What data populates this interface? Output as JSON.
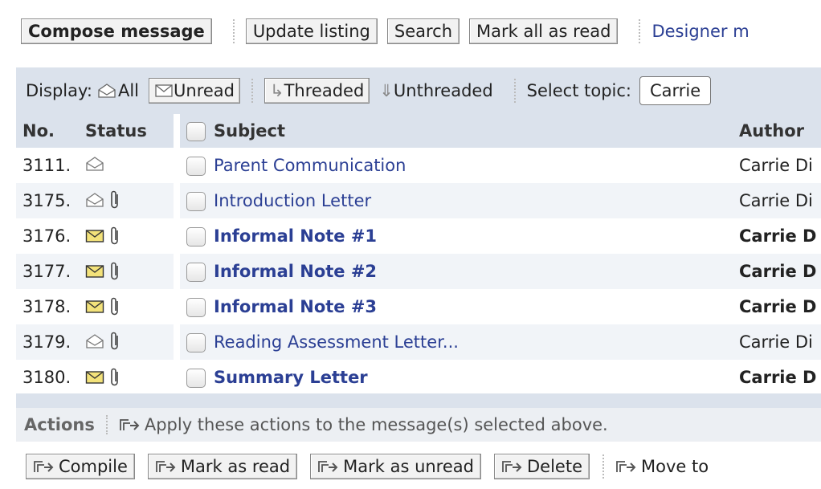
{
  "toolbar": {
    "compose": "Compose message",
    "update": "Update listing",
    "search": "Search",
    "mark_all_read": "Mark all as read",
    "designer_link": "Designer m"
  },
  "display": {
    "label": "Display:",
    "all": "All",
    "unread": "Unread",
    "threaded": "Threaded",
    "unthreaded": "Unthreaded",
    "topic_label": "Select topic:",
    "topic_value": "Carrie"
  },
  "table": {
    "headers": {
      "no": "No.",
      "status": "Status",
      "subject": "Subject",
      "author": "Author"
    },
    "rows": [
      {
        "no": "3111.",
        "subject": "Parent Communication",
        "author": "Carrie Di",
        "unread": false,
        "attachment": false
      },
      {
        "no": "3175.",
        "subject": "Introduction Letter",
        "author": "Carrie Di",
        "unread": false,
        "attachment": true
      },
      {
        "no": "3176.",
        "subject": "Informal Note #1",
        "author": "Carrie D",
        "unread": true,
        "attachment": true
      },
      {
        "no": "3177.",
        "subject": "Informal Note #2",
        "author": "Carrie D",
        "unread": true,
        "attachment": true
      },
      {
        "no": "3178.",
        "subject": "Informal Note #3",
        "author": "Carrie D",
        "unread": true,
        "attachment": true
      },
      {
        "no": "3179.",
        "subject": "Reading Assessment Letter...",
        "author": "Carrie Di",
        "unread": false,
        "attachment": true
      },
      {
        "no": "3180.",
        "subject": "Summary Letter",
        "author": "Carrie D",
        "unread": true,
        "attachment": true
      }
    ]
  },
  "actions": {
    "title": "Actions",
    "description": "Apply these actions to the message(s) selected above.",
    "compile": "Compile",
    "mark_read": "Mark as read",
    "mark_unread": "Mark as unread",
    "delete": "Delete",
    "move_to": "Move to"
  },
  "icons": {
    "envelope_read": "open-envelope-icon",
    "envelope_unread": "closed-envelope-icon",
    "attachment": "paperclip-icon",
    "action_arrow": "action-arrow-icon"
  },
  "colors": {
    "link": "#2b3f94",
    "header_bg": "#dbe2ec",
    "row_alt": "#f1f4f8",
    "unread_env": "#f3e27a"
  }
}
